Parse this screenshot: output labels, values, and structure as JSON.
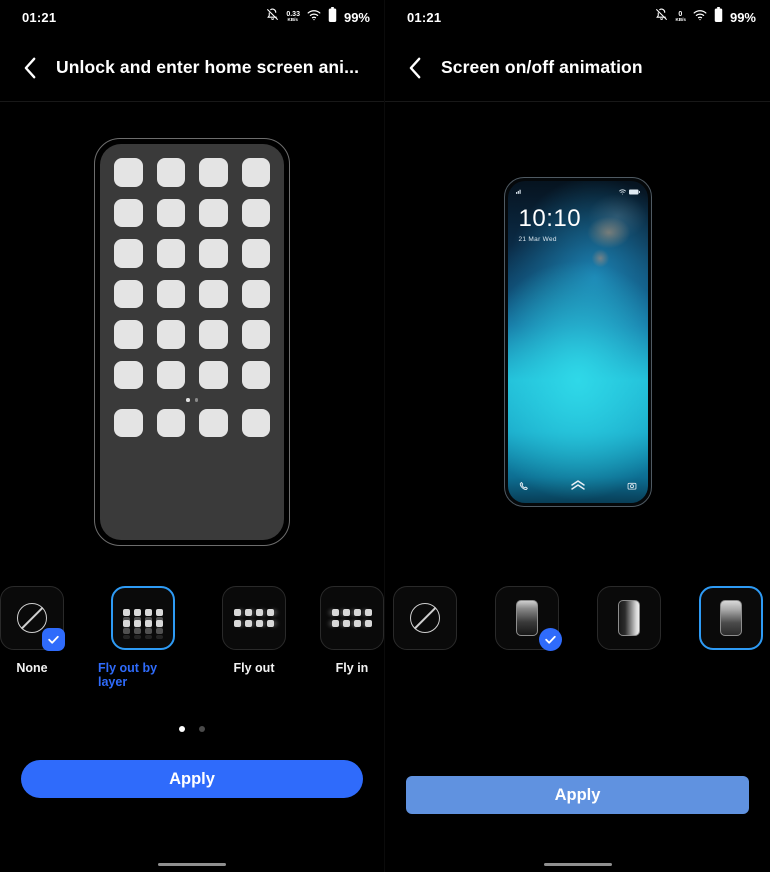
{
  "left_panel": {
    "status_bar": {
      "time": "01:21",
      "net_speed_value": "0.33",
      "net_speed_unit": "KB/s",
      "battery_percent": "99%",
      "icons": [
        "bell-muted-icon",
        "network-speed-icon",
        "wifi-icon",
        "battery-icon"
      ]
    },
    "title": "Unlock and enter home screen ani...",
    "back_icon": "chevron-left-icon",
    "preview": {
      "type": "home-screen-mock",
      "grid_columns": 4,
      "grid_rows": 6,
      "dock_icons": 4,
      "page_dots": 2,
      "active_page_dot": 1
    },
    "options": [
      {
        "label": "None",
        "icon": "slash-circle-icon",
        "selected": true,
        "focused": false
      },
      {
        "label": "Fly out by layer",
        "icon": "grid-layers-icon",
        "selected": false,
        "focused": true
      },
      {
        "label": "Fly out",
        "icon": "grid-blur-right-icon",
        "selected": false,
        "focused": false
      },
      {
        "label": "Fly in",
        "icon": "grid-blur-left-icon",
        "selected": false,
        "focused": false
      }
    ],
    "pagination": {
      "count": 2,
      "active_index": 0
    },
    "apply_label": "Apply"
  },
  "right_panel": {
    "status_bar": {
      "time": "01:21",
      "net_speed_value": "0",
      "net_speed_unit": "KB/s",
      "battery_percent": "99%",
      "icons": [
        "bell-muted-icon",
        "network-speed-icon",
        "wifi-icon",
        "battery-icon"
      ]
    },
    "title": "Screen on/off animation",
    "back_icon": "chevron-left-icon",
    "preview": {
      "type": "lock-screen-mock",
      "clock": "10:10",
      "date": "21 Mar  Wed",
      "bottom_icons": [
        "phone-icon",
        "chevron-double-up-icon",
        "camera-icon"
      ],
      "status_icons": [
        "wifi-icon",
        "battery-icon"
      ]
    },
    "options": [
      {
        "label": "",
        "icon": "slash-circle-icon",
        "selected": false,
        "focused": false
      },
      {
        "label": "",
        "icon": "phone-fade-icon",
        "selected": true,
        "focused": false
      },
      {
        "label": "",
        "icon": "phone-side-glow-icon",
        "selected": false,
        "focused": false
      },
      {
        "label": "",
        "icon": "phone-top-fade-icon",
        "selected": false,
        "focused": true
      }
    ],
    "apply_label": "Apply"
  },
  "colors": {
    "accent_blue": "#2f6bfb",
    "focus_blue": "#2e9bf5",
    "apply_muted": "#6092e0",
    "background": "#000000"
  }
}
